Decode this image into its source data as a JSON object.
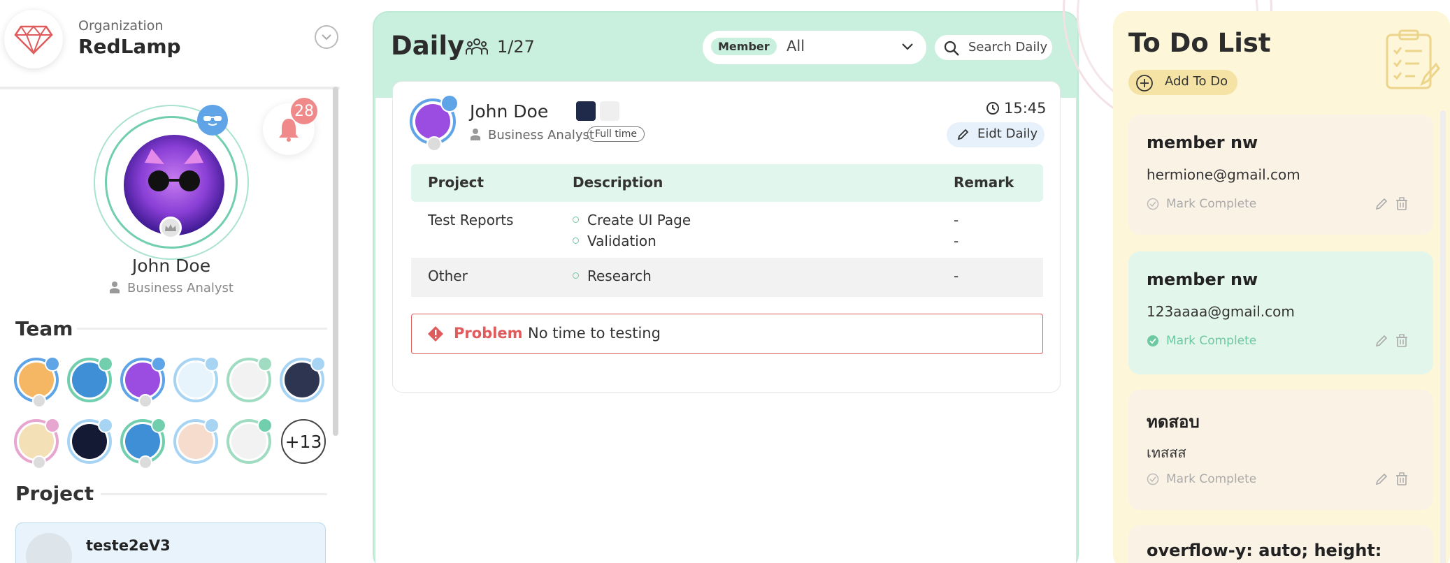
{
  "org": {
    "label": "Organization",
    "name": "RedLamp"
  },
  "profile": {
    "name": "John Doe",
    "role": "Business Analyst",
    "notification_count": "28"
  },
  "team": {
    "title": "Team",
    "more_label": "+13"
  },
  "project": {
    "title": "Project",
    "first_name": "teste2eV3"
  },
  "daily": {
    "title": "Daily",
    "count": "1/27",
    "member_label": "Member",
    "member_value": "All",
    "search_placeholder": "Search Daily",
    "entry": {
      "name": "John Doe",
      "role": "Business Analyst",
      "employment": "Full time",
      "time": "15:45",
      "edit_label": "Eidt Daily",
      "columns": [
        "Project",
        "Description",
        "Remark"
      ],
      "rows": [
        {
          "project": "Test Reports",
          "items": [
            "Create UI Page",
            "Validation"
          ],
          "remarks": [
            "-",
            "-"
          ]
        },
        {
          "project": "Other",
          "items": [
            "Research"
          ],
          "remarks": [
            "-"
          ]
        }
      ],
      "problem_label": "Problem",
      "problem_text": "No time to testing"
    }
  },
  "todo": {
    "title": "To Do List",
    "add_label": "Add To Do",
    "mark_label": "Mark Complete",
    "items": [
      {
        "title": "member nw",
        "detail": "hermione@gmail.com"
      },
      {
        "title": "member nw",
        "detail": "123aaaa@gmail.com"
      },
      {
        "title": "ทดสอบ",
        "detail": "เทสสส"
      },
      {
        "title": "overflow-y: auto; height:",
        "detail": ""
      }
    ]
  },
  "colors": {
    "daily_bg": "#c9f0df",
    "todo_bg": "#fdf6d9",
    "accent_blue": "#5fa4e6",
    "accent_green": "#72cfae",
    "problem_red": "#e05b5b",
    "bell_red": "#f08a8a"
  }
}
